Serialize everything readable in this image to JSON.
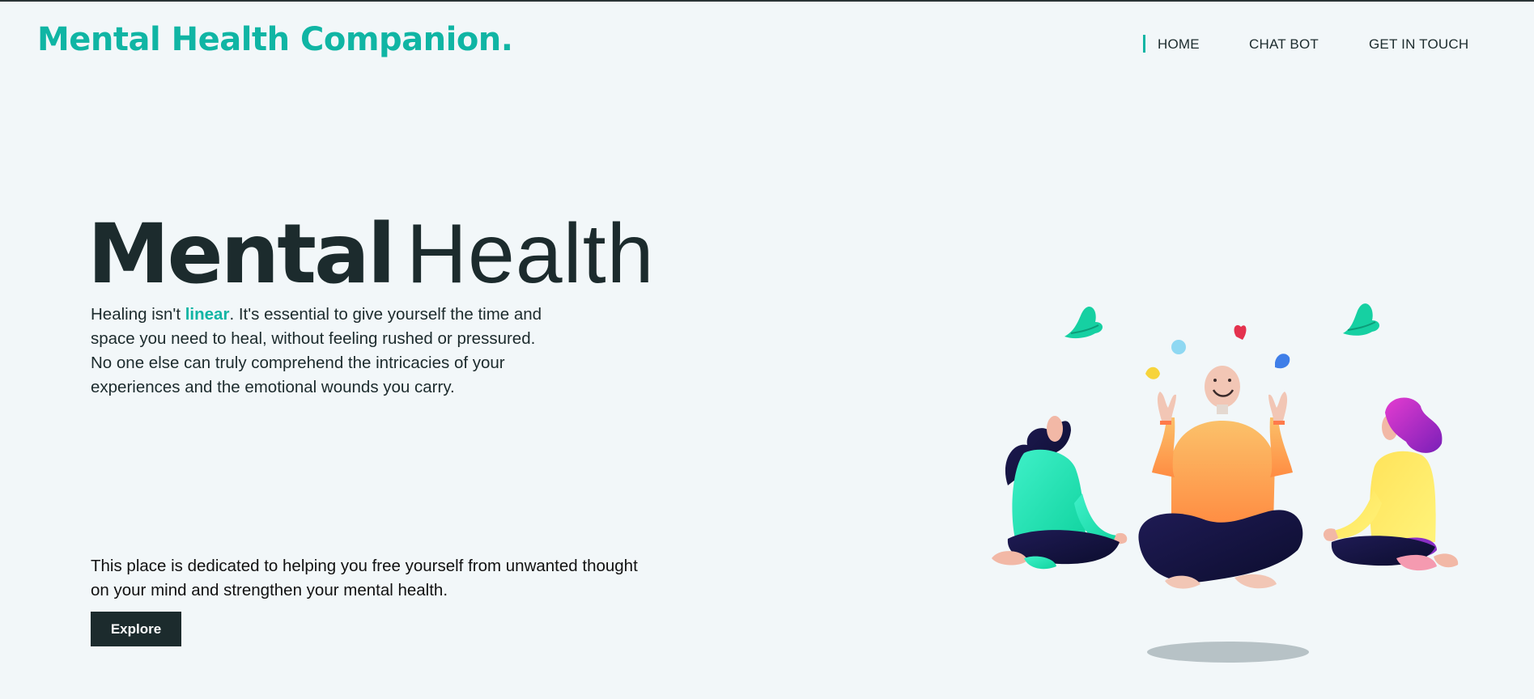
{
  "header": {
    "brand": "Mental Health Companion.",
    "nav": [
      {
        "label": "HOME",
        "active": true
      },
      {
        "label": "CHAT BOT",
        "active": false
      },
      {
        "label": "GET IN TOUCH",
        "active": false
      }
    ]
  },
  "hero": {
    "title_bold": "Mental",
    "title_light": "Health",
    "text_before": "Healing isn't ",
    "text_accent": "linear",
    "text_after": ". It's essential to give yourself the time and space you need to heal, without feeling rushed or pressured. No one else can truly comprehend the intricacies of your experiences and the emotional wounds you carry.",
    "dedicated": "This place is dedicated to helping you free yourself from unwanted thought on your mind and strengthen your mental health.",
    "button_label": "Explore"
  },
  "colors": {
    "accent": "#10b5a4",
    "dark": "#1c2b2d",
    "background": "#f2f7f9"
  },
  "illustration": {
    "icon": "meditation-illustration"
  }
}
